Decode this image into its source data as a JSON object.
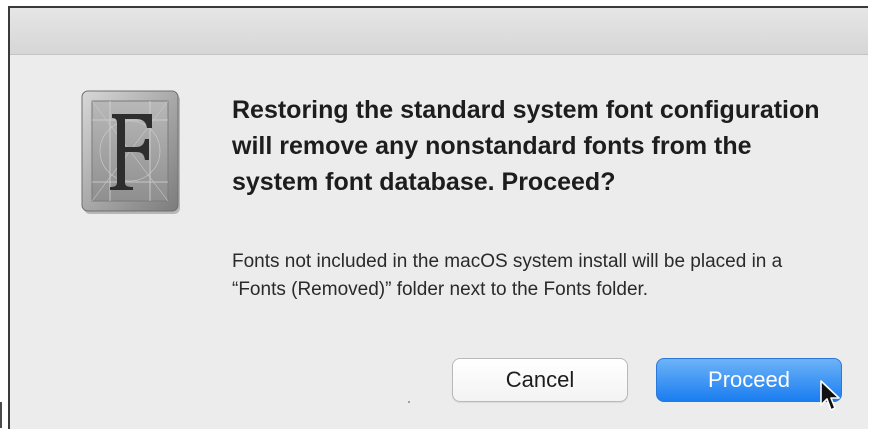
{
  "dialog": {
    "icon": "font-book-icon",
    "headline": "Restoring the standard system font configuration will remove any nonstandard fonts from the system font database. Proceed?",
    "body": "Fonts not included in the macOS system install will be placed in a “Fonts (Removed)” folder next to the Fonts folder.",
    "buttons": {
      "cancel_label": "Cancel",
      "proceed_label": "Proceed"
    }
  },
  "colors": {
    "dialog_background": "#ececec",
    "default_button": "#1a7df0",
    "default_button_text": "#ffffff"
  }
}
